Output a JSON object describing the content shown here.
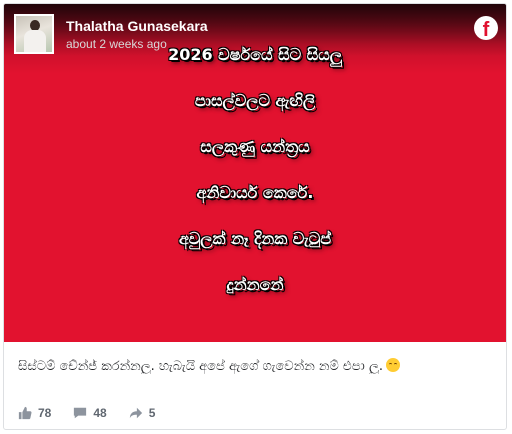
{
  "post": {
    "page_name": "Thalatha Gunasekara",
    "time_ago": "about 2 weeks ago",
    "image_text_lines": [
      "2026 වර්ෂයේ සිට සියලු",
      "පාසල්වලට ඇඟිලි",
      "සලකුණු යන්ත්‍රය",
      "අනිවාර්ය කෙරේ.",
      "අවුලක් නෑ දිනක වැටුප්",
      "දුන්නනේ"
    ],
    "caption": "සිස්ටම් චේන්ජ් කරන්නලු. හැබැයි අපේ ඇගේ ගැවෙන්න නම් එපා ලු.",
    "caption_emoji": "grinning-face-emoji"
  },
  "stats": {
    "likes": "78",
    "comments": "48",
    "shares": "5"
  },
  "colors": {
    "brand_red": "#e2122f",
    "text_muted": "#606770"
  },
  "icons": {
    "platform": "facebook-icon",
    "like": "thumbs-up-icon",
    "comment": "comment-icon",
    "share": "share-arrow-icon"
  }
}
